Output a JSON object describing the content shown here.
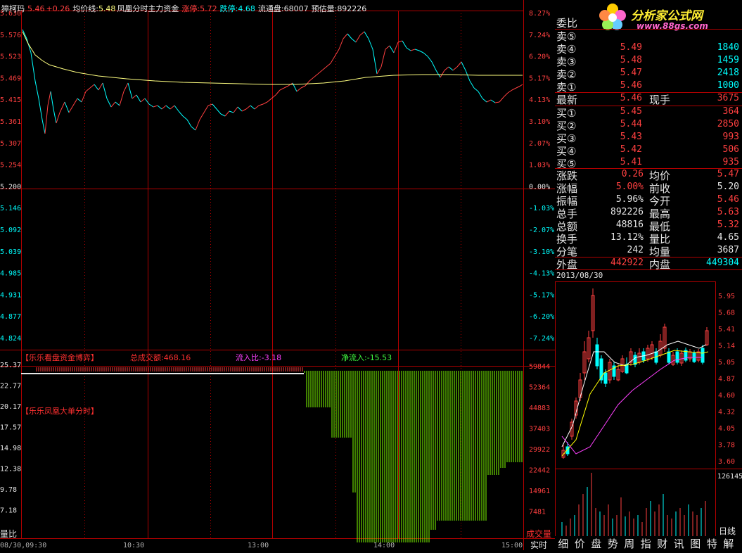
{
  "header": {
    "stock_name": "獐柯玛",
    "price": "5.46",
    "change": "+0.26",
    "avg_label": "均价线:",
    "avg_value": "5.48",
    "indicator_label": "凤凰分时主力资金",
    "limit_up_label": "涨停:",
    "limit_up_value": "5.72",
    "limit_down_label": "跌停:",
    "limit_down_value": "4.68",
    "float_label": "流通盘:",
    "float_value": "68007",
    "est_vol_label": "预估量:",
    "est_vol_value": "892226"
  },
  "price_axis_left": [
    "5.630",
    "5.576",
    "5.523",
    "5.469",
    "5.415",
    "5.361",
    "5.307",
    "5.254",
    "5.200",
    "5.146",
    "5.092",
    "5.039",
    "4.985",
    "4.931",
    "4.877",
    "4.824"
  ],
  "pct_axis_right": [
    "8.27%",
    "7.24%",
    "6.20%",
    "5.17%",
    "4.13%",
    "3.10%",
    "2.07%",
    "1.03%",
    "0.00%",
    "-1.03%",
    "-2.07%",
    "-3.10%",
    "-4.13%",
    "-5.17%",
    "-6.20%",
    "-7.24%"
  ],
  "indicator_panel": {
    "title": "【乐乐看盘资金博弈】",
    "total_label": "总成交额:",
    "total_value": "468.16",
    "inflow_ratio_label": "流入比:",
    "inflow_ratio_value": "-3.18",
    "net_inflow_label": "净流入:",
    "net_inflow_value": "-15.53",
    "subtitle": "【乐乐凤凰大单分时】",
    "left_axis": [
      "25.37",
      "22.77",
      "20.17",
      "17.57",
      "14.98",
      "12.38",
      "9.78",
      "7.18"
    ],
    "left_axis_bottom": "量比",
    "right_axis": [
      "59844",
      "52364",
      "44883",
      "37403",
      "29922",
      "22442",
      "14961",
      "7481"
    ],
    "right_axis_bottom": "成交量"
  },
  "time_axis": [
    "09:30",
    "10:30",
    "13:00",
    "14:00",
    "15:00"
  ],
  "time_axis_first": "08/30,09:30",
  "realtime_label": "实时",
  "order_book": {
    "title": "委比",
    "sells": [
      {
        "label": "卖⑤",
        "price": "",
        "vol": ""
      },
      {
        "label": "卖④",
        "price": "5.49",
        "vol": "1840"
      },
      {
        "label": "卖③",
        "price": "5.48",
        "vol": "1459"
      },
      {
        "label": "卖②",
        "price": "5.47",
        "vol": "2418"
      },
      {
        "label": "卖①",
        "price": "5.46",
        "vol": "1000"
      }
    ],
    "latest_label": "最新",
    "latest_price": "5.46",
    "cur_vol_label": "现手",
    "cur_vol": "3675",
    "buys": [
      {
        "label": "买①",
        "price": "5.45",
        "vol": "364"
      },
      {
        "label": "买②",
        "price": "5.44",
        "vol": "2850"
      },
      {
        "label": "买③",
        "price": "5.43",
        "vol": "993"
      },
      {
        "label": "买④",
        "price": "5.42",
        "vol": "506"
      },
      {
        "label": "买⑤",
        "price": "5.41",
        "vol": "935"
      }
    ]
  },
  "stats": [
    {
      "l1": "涨跌",
      "v1": "0.26",
      "c1": "#ff4040",
      "l2": "均价",
      "v2": "5.47",
      "c2": "#ff4040"
    },
    {
      "l1": "涨幅",
      "v1": "5.00%",
      "c1": "#ff4040",
      "l2": "前收",
      "v2": "5.20",
      "c2": "#e6e6e6"
    },
    {
      "l1": "振幅",
      "v1": "5.96%",
      "c1": "#e6e6e6",
      "l2": "今开",
      "v2": "5.46",
      "c2": "#ff4040"
    },
    {
      "l1": "总手",
      "v1": "892226",
      "c1": "#e6e6e6",
      "l2": "最高",
      "v2": "5.63",
      "c2": "#ff4040"
    },
    {
      "l1": "总额",
      "v1": "48816",
      "c1": "#e6e6e6",
      "l2": "最低",
      "v2": "5.32",
      "c2": "#ff4040"
    },
    {
      "l1": "换手",
      "v1": "13.12%",
      "c1": "#e6e6e6",
      "l2": "量比",
      "v2": "4.65",
      "c2": "#e6e6e6"
    },
    {
      "l1": "分笔",
      "v1": "242",
      "c1": "#e6e6e6",
      "l2": "均量",
      "v2": "3687",
      "c2": "#e6e6e6"
    }
  ],
  "outer_label": "外盘",
  "outer_value": "442922",
  "inner_label": "内盘",
  "inner_value": "449304",
  "mini_chart": {
    "date": "2013/08/30",
    "price_axis": [
      "5.95",
      "5.68",
      "5.41",
      "5.14",
      "5.05",
      "4.87",
      "4.60",
      "4.32",
      "4.05",
      "3.78",
      "3.60"
    ],
    "vol_top": "126145",
    "vol_label": "日线"
  },
  "bottom_tabs": [
    "细",
    "价",
    "盘",
    "势",
    "周",
    "指",
    "财",
    "讯",
    "图",
    "特",
    "解"
  ],
  "watermark": {
    "brand": "分析家公式网",
    "url": "www.88gs.com"
  },
  "colors": {
    "up": "#ff4040",
    "down": "#00ffff",
    "grid": "#b00000",
    "avg_line": "#ffff80",
    "inflow_bar": "#7fff00",
    "label_red": "#ff3030",
    "label_magenta": "#ff40ff",
    "label_green": "#40ff40"
  }
}
